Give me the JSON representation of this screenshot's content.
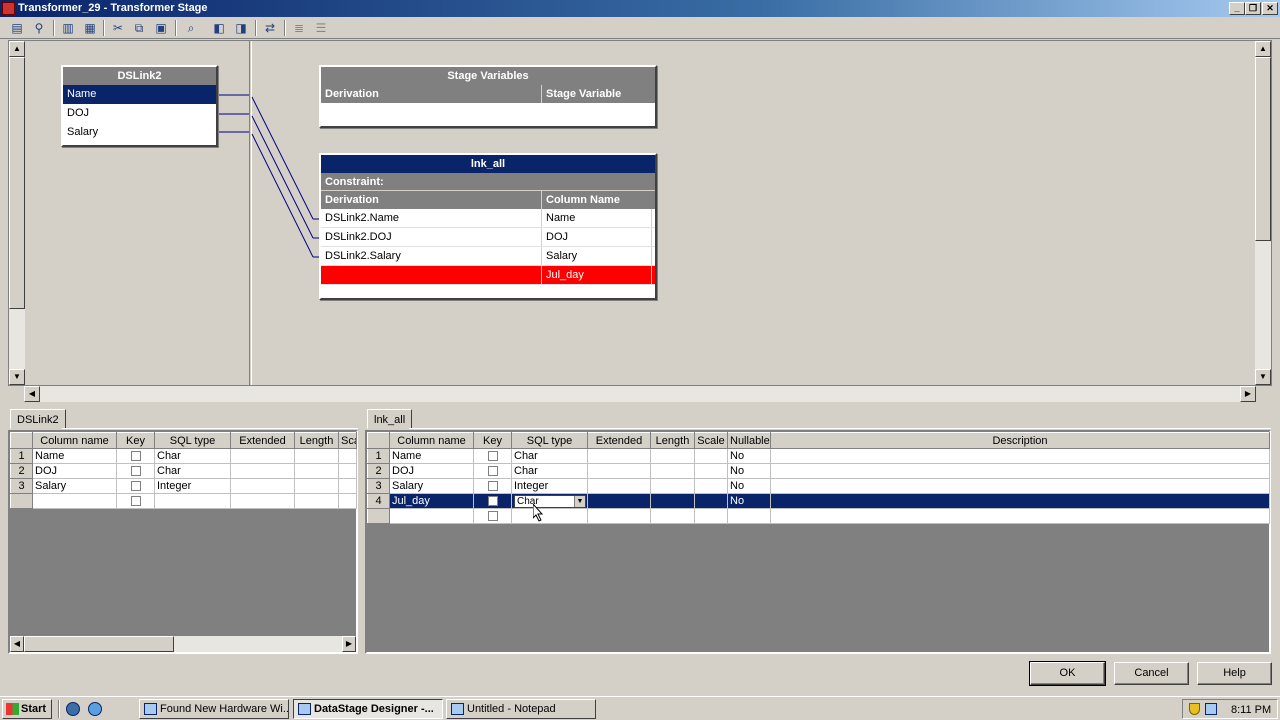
{
  "window": {
    "title": "Transformer_29 - Transformer Stage",
    "minimize": "_",
    "restore": "❐",
    "close": "✕"
  },
  "toolbar": {
    "icons": [
      "properties-icon",
      "link-icon",
      "column-icon",
      "grid-icon",
      "cut-icon",
      "copy-icon",
      "paste-icon",
      "find-icon",
      "load-icon",
      "save-icon",
      "input-order-icon",
      "output-order-icon",
      "autofit-icon"
    ]
  },
  "dslink2_box": {
    "title": "DSLink2",
    "rows": [
      "Name",
      "DOJ",
      "Salary"
    ],
    "selected_index": 0
  },
  "stage_vars": {
    "title": "Stage Variables",
    "col1": "Derivation",
    "col2": "Stage Variable"
  },
  "lnk_all_box": {
    "title": "lnk_all",
    "constraint": "Constraint:",
    "col1": "Derivation",
    "col2": "Column Name",
    "rows": [
      {
        "derivation": "DSLink2.Name",
        "column": "Name"
      },
      {
        "derivation": "DSLink2.DOJ",
        "column": "DOJ"
      },
      {
        "derivation": "DSLink2.Salary",
        "column": "Salary"
      },
      {
        "derivation": "",
        "column": "Jul_day"
      }
    ]
  },
  "left_grid": {
    "tab": "DSLink2",
    "headers": [
      "Column name",
      "Key",
      "SQL type",
      "Extended",
      "Length",
      "Sca"
    ],
    "rows": [
      {
        "n": "1",
        "name": "Name",
        "type": "Char"
      },
      {
        "n": "2",
        "name": "DOJ",
        "type": "Char"
      },
      {
        "n": "3",
        "name": "Salary",
        "type": "Integer"
      }
    ]
  },
  "right_grid": {
    "tab": "lnk_all",
    "headers": [
      "Column name",
      "Key",
      "SQL type",
      "Extended",
      "Length",
      "Scale",
      "Nullable",
      "Description"
    ],
    "rows": [
      {
        "n": "1",
        "name": "Name",
        "type": "Char",
        "nullable": "No"
      },
      {
        "n": "2",
        "name": "DOJ",
        "type": "Char",
        "nullable": "No"
      },
      {
        "n": "3",
        "name": "Salary",
        "type": "Integer",
        "nullable": "No"
      },
      {
        "n": "4",
        "name": "Jul_day",
        "type": "Char",
        "nullable": "No"
      }
    ]
  },
  "buttons": {
    "ok": "OK",
    "cancel": "Cancel",
    "help": "Help"
  },
  "taskbar": {
    "start": "Start",
    "tasks": [
      "Found New Hardware Wi...",
      "DataStage Designer -...",
      "Untitled - Notepad"
    ],
    "clock": "8:11 PM"
  },
  "colors": {
    "selection": "#0a246a",
    "error_row": "#ff0000",
    "header_gray": "#808080"
  }
}
